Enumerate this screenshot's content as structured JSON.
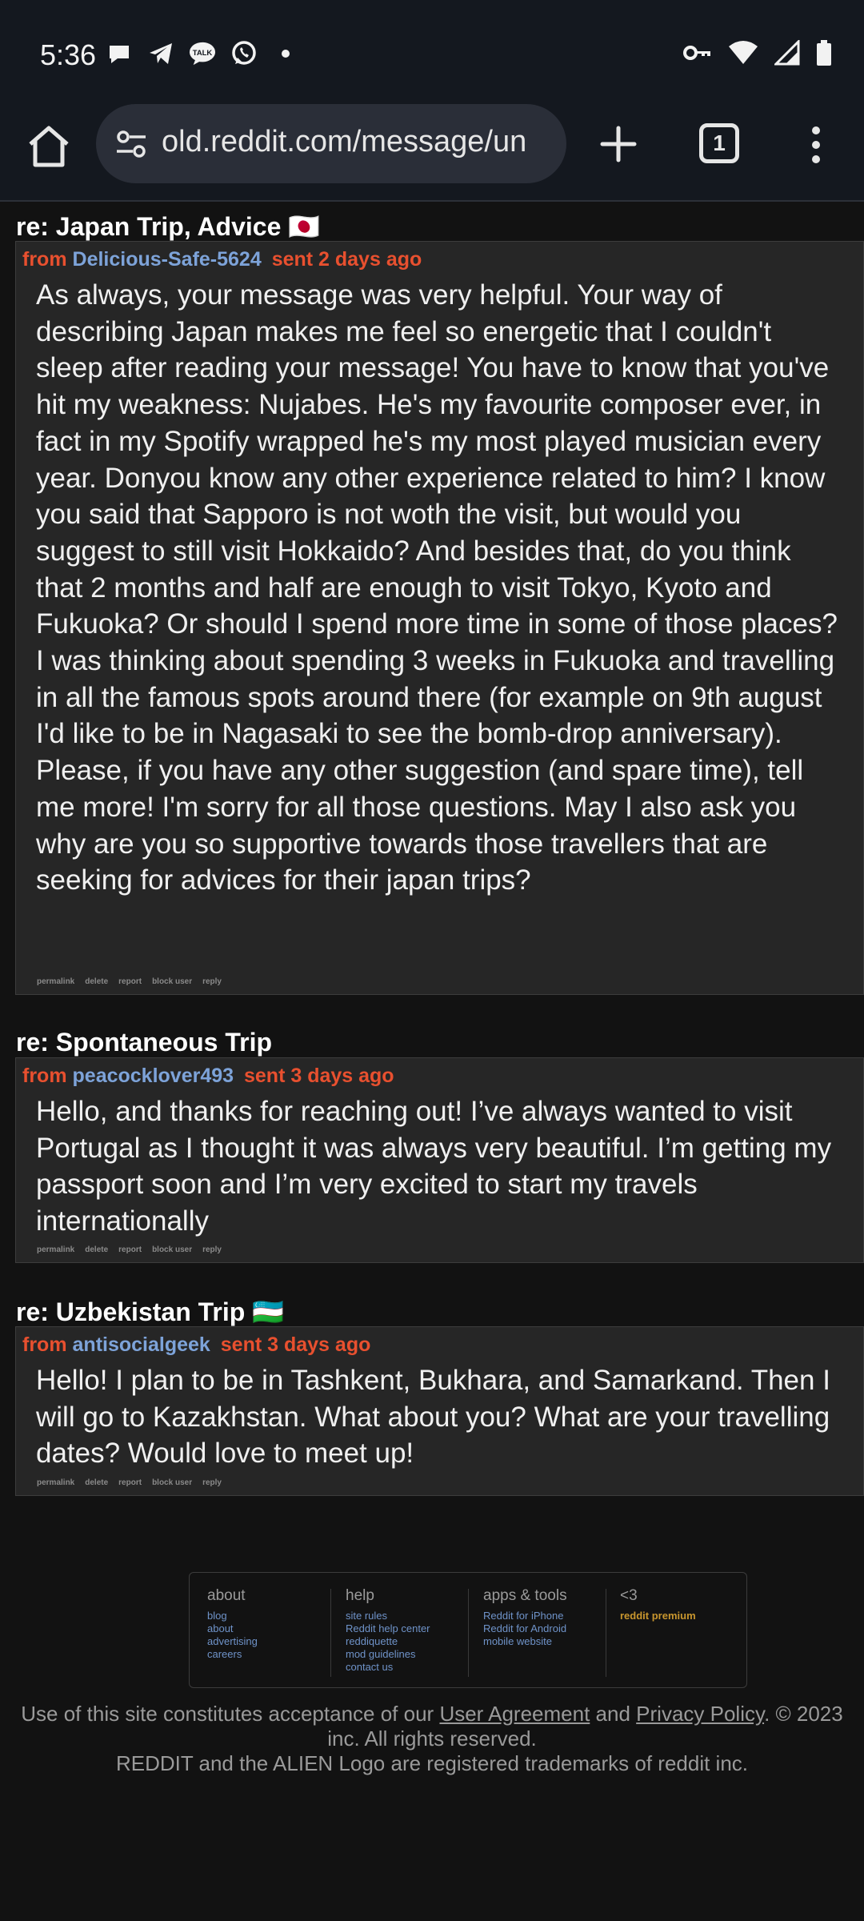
{
  "status_bar": {
    "time": "5:36",
    "notif_icons": [
      "chat-bubble-icon",
      "telegram-icon",
      "kakaotalk-icon",
      "whatsapp-icon",
      "dot-icon"
    ],
    "talk_label": "TALK",
    "right_icons": [
      "vpn-key-icon",
      "wifi-icon",
      "signal-icon",
      "battery-icon"
    ]
  },
  "browser": {
    "url": "old.reddit.com/message/un",
    "tab_count": "1"
  },
  "messages": [
    {
      "subject": "re: Japan Trip, Advice 🇯🇵",
      "from_label": "from",
      "author": "Delicious-Safe-5624",
      "sent": "sent 2 days ago",
      "body": "As always, your message was very helpful. Your way of describing Japan makes me feel so energetic that I couldn't sleep after reading your message! You have to know that you've hit my weakness: Nujabes. He's my favourite composer ever, in fact in my Spotify wrapped he's my most played musician every year. Donyou know any other experience related to him? I know you said that Sapporo is not woth the visit, but would you suggest to still visit Hokkaido? And besides that, do you think that 2 months and half are enough to visit Tokyo, Kyoto and Fukuoka? Or should I spend more time in some of those places? I was thinking about spending 3 weeks in Fukuoka and travelling in all the famous spots around there (for example on 9th august I'd like to be in Nagasaki to see the bomb-drop anniversary). Please, if you have any other suggestion (and spare time), tell me more! I'm sorry for all those questions. May I also ask you why are you so supportive towards those travellers that are seeking for advices for their japan trips?"
    },
    {
      "subject": "re: Spontaneous Trip",
      "from_label": "from",
      "author": "peacocklover493",
      "sent": "sent 3 days ago",
      "body": "Hello, and thanks for reaching out! I’ve always wanted to visit Portugal as I thought it was always very beautiful. I’m getting my passport soon and I’m very excited to start my travels internationally"
    },
    {
      "subject": "re: Uzbekistan Trip 🇺🇿",
      "from_label": "from",
      "author": "antisocialgeek",
      "sent": "sent 3 days ago",
      "body": "Hello! I plan to be in Tashkent, Bukhara, and Samarkand. Then I will go to Kazakhstan. What about you? What are your travelling dates? Would love to meet up!"
    }
  ],
  "actions": {
    "permalink": "permalink",
    "delete": "delete",
    "report": "report",
    "block_user": "block user",
    "reply": "reply"
  },
  "footer": {
    "about": {
      "title": "about",
      "links": [
        "blog",
        "about",
        "advertising",
        "careers"
      ]
    },
    "help": {
      "title": "help",
      "links": [
        "site rules",
        "Reddit help center",
        "reddiquette",
        "mod guidelines",
        "contact us"
      ]
    },
    "apps": {
      "title": "apps & tools",
      "links": [
        "Reddit for iPhone",
        "Reddit for Android",
        "mobile website"
      ]
    },
    "love": {
      "title": "<3",
      "links": [
        "reddit premium"
      ]
    }
  },
  "legal": {
    "prefix": "Use of this site constitutes acceptance of our",
    "user_agreement": "User Agreement",
    "and": "and",
    "privacy_policy": "Privacy Policy",
    "suffix": ". © 2023",
    "line2": "inc. All rights reserved.",
    "line3": "REDDIT and the ALIEN Logo are registered trademarks of reddit inc."
  },
  "colors": {
    "from_label": "#e8502f",
    "author": "#7da3d9",
    "premium": "#c8962e",
    "background": "#121212",
    "message_box": "#262626"
  }
}
